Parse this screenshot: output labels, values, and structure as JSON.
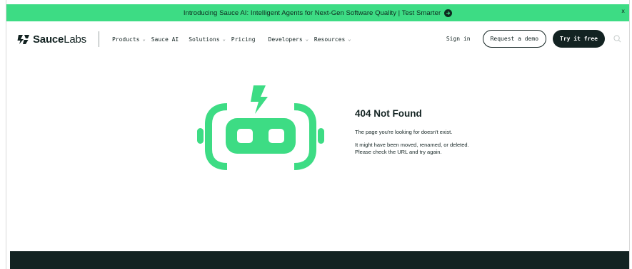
{
  "banner": {
    "text": "Introducing Sauce AI: Intelligent Agents for Next-Gen Software Quality | Test Smarter",
    "close_label": "x"
  },
  "nav": {
    "logo_bold": "Sauce",
    "logo_light": "Labs",
    "items": [
      {
        "label": "Products",
        "dropdown": true
      },
      {
        "label": "Sauce AI",
        "dropdown": false
      },
      {
        "label": "Solutions",
        "dropdown": true
      },
      {
        "label": "Pricing",
        "dropdown": false
      },
      {
        "label": "Developers",
        "dropdown": true
      },
      {
        "label": "Resources",
        "dropdown": true
      }
    ],
    "sign_in": "Sign in",
    "request_demo": "Request a demo",
    "try_free": "Try it free"
  },
  "main": {
    "title": "404 Not Found",
    "message": "The page you're looking for doesn't exist.",
    "detail": "It might have been moved, renamed, or deleted. Please check the URL and try again."
  },
  "colors": {
    "brand_green": "#3ddc84",
    "dark": "#132322"
  }
}
